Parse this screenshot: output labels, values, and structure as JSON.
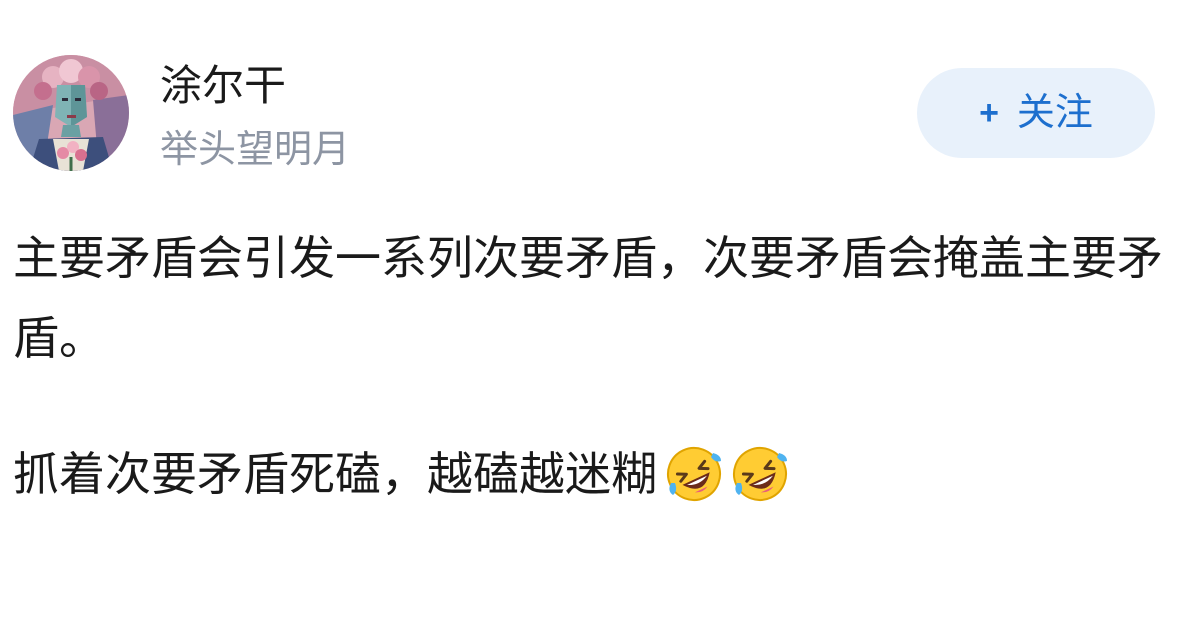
{
  "author": {
    "name": "涂尔干",
    "subtitle": "举头望明月",
    "avatar_icon": "avatar-portrait-image"
  },
  "follow_button": {
    "plus": "+",
    "label": "关注",
    "background": "#e8f1fb",
    "text_color": "#1d6fce"
  },
  "post": {
    "paragraphs": [
      "主要矛盾会引发一系列次要矛盾，次要矛盾会掩盖主要矛盾。",
      "抓着次要矛盾死磕，越磕越迷糊"
    ],
    "trailing_emoji": [
      "rolling-on-floor-laughing-icon",
      "rolling-on-floor-laughing-icon"
    ]
  },
  "colors": {
    "primary_text": "#1a1a1a",
    "secondary_text": "#8d95a3",
    "accent": "#1d6fce"
  }
}
